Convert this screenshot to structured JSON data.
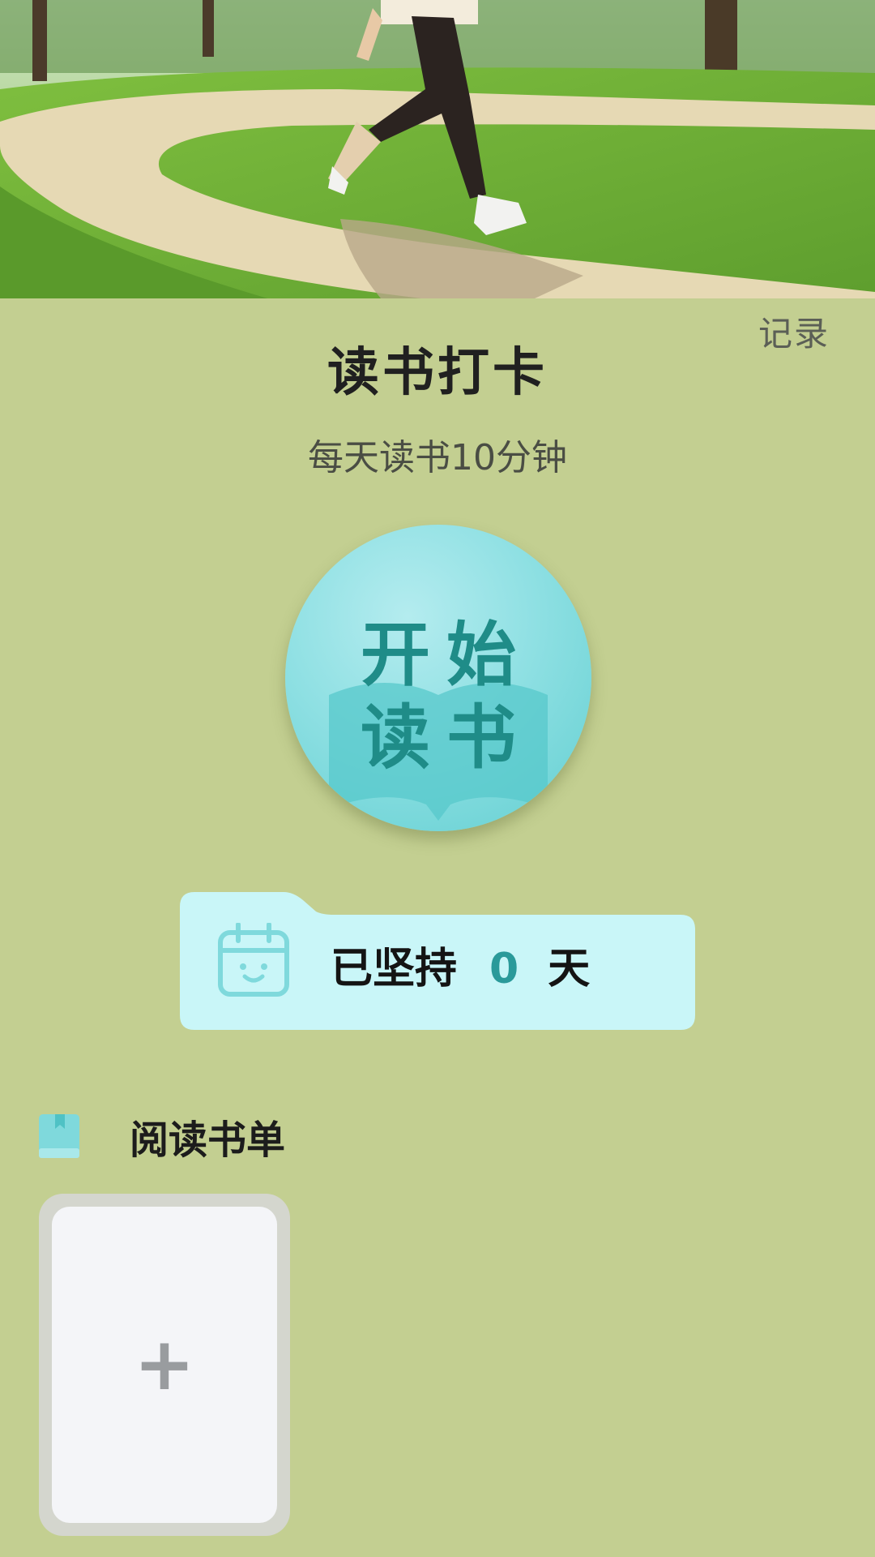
{
  "header": {
    "record_label": "记录",
    "title": "读书打卡",
    "subtitle": "每天读书10分钟"
  },
  "start_button": {
    "line1": "开始",
    "line2": "读书"
  },
  "streak": {
    "prefix": "已坚持",
    "count": "0",
    "suffix": "天",
    "icon": "calendar-smile-icon"
  },
  "reading_list": {
    "icon": "book-icon",
    "title": "阅读书单",
    "add_symbol": "+"
  },
  "colors": {
    "background": "#c3cf91",
    "button_teal": "#62cfd1",
    "button_text": "#1f8c88",
    "streak_card": "#c9f6f8",
    "streak_count": "#2a9a9a"
  }
}
